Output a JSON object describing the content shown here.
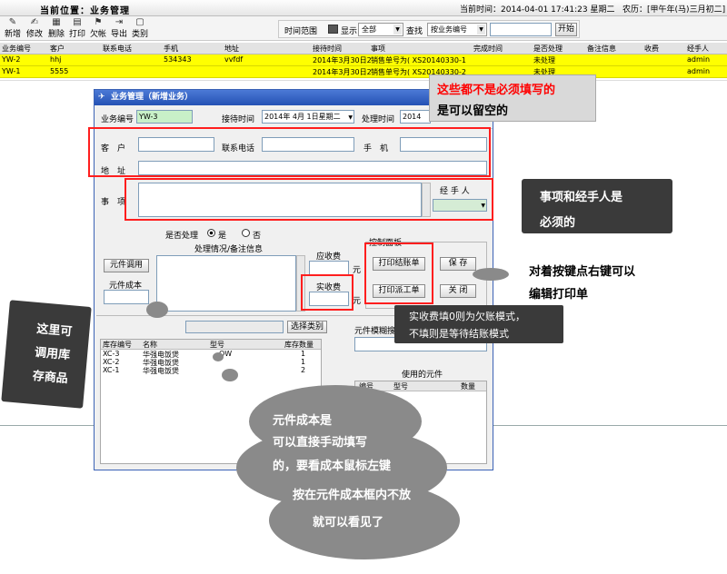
{
  "topbar": {
    "location": "当前位置：业务管理",
    "time": "当前时间：2014-04-01 17:41:23 星期二   农历：[甲午年(马)三月初二]"
  },
  "toolbar": {
    "buttons": [
      "新增",
      "修改",
      "删除",
      "打印",
      "欠帐",
      "导出",
      "类别"
    ]
  },
  "filters": {
    "range_label": "时间范围",
    "display": "显示",
    "display_value": "全部",
    "find": "查找",
    "find_value": "按业务编号",
    "start": "开始"
  },
  "table": {
    "columns": [
      "业务编号",
      "客户",
      "联系电话",
      "手机",
      "地址",
      "接待时间",
      "事项",
      "完成时间",
      "是否处理",
      "备注信息",
      "收费",
      "经手人"
    ],
    "rows": [
      [
        "YW-2",
        "hhj",
        "",
        "534343",
        "vvfdf",
        "2014年3月30日2",
        "销售单号为( XS20140330-1",
        "",
        "未处理",
        "",
        "",
        "admin"
      ],
      [
        "YW-1",
        "5555",
        "",
        "",
        "",
        "2014年3月30日2",
        "销售单号为( XS20140330-2",
        "",
        "未处理",
        "",
        "",
        "admin"
      ]
    ]
  },
  "dialog": {
    "title": "业务管理（新增业务）",
    "biz_no_label": "业务编号",
    "biz_no": "YW-3",
    "recv_time_label": "接待时间",
    "recv_time": "2014年 4月 1日星期二",
    "proc_time_label": "处理时间",
    "proc_time": "2014",
    "customer_label": "客　户",
    "phone_label": "联系电话",
    "mobile_label": "手　机",
    "address_label": "地　址",
    "matter_label": "事　项",
    "handler_label": "经 手 人",
    "processed_label": "是否处理",
    "yes": "是",
    "no": "否",
    "remark_label": "处理情况/备注信息",
    "component_call": "元件调用",
    "component_cost": "元件成本",
    "receivable": "应收费",
    "received": "实收费",
    "yuan": "元",
    "control_panel": "控制面板",
    "print_settle": "打印结账单",
    "print_dispatch": "打印派工单",
    "save": "保 存",
    "close": "关 闭",
    "select_category": "选择类别",
    "fuzzy_label": "元件模糊搜",
    "used_components": "使用的元件",
    "stock_cols": [
      "库存编号",
      "名称",
      "型号",
      "库存数量"
    ],
    "stock_rows": [
      [
        "XC-3",
        "华强电饭煲",
        "OW",
        "1"
      ],
      [
        "XC-2",
        "华强电饭煲",
        "",
        "1"
      ],
      [
        "XC-1",
        "华强电饭煲",
        "",
        "2"
      ]
    ],
    "used_cols": [
      "编号",
      "型号",
      "数量"
    ]
  },
  "annotations": {
    "not_required": [
      "这些都不是必须填写的",
      "是可以留空的"
    ],
    "required": [
      "事项和经手人是",
      "必须的"
    ],
    "right_click": [
      "对着按键点右键可以",
      "编辑打印单"
    ],
    "receipt_note": [
      "实收费填0则为欠账模式，",
      "不填则是等待结账模式"
    ],
    "stock_call": [
      "这里可",
      "调用库",
      "存商品"
    ],
    "cost_note": [
      "元件成本是",
      "可以直接手动填写",
      "的，要看成本鼠标左键",
      "按在元件成本框内不放",
      "就可以看见了"
    ]
  }
}
